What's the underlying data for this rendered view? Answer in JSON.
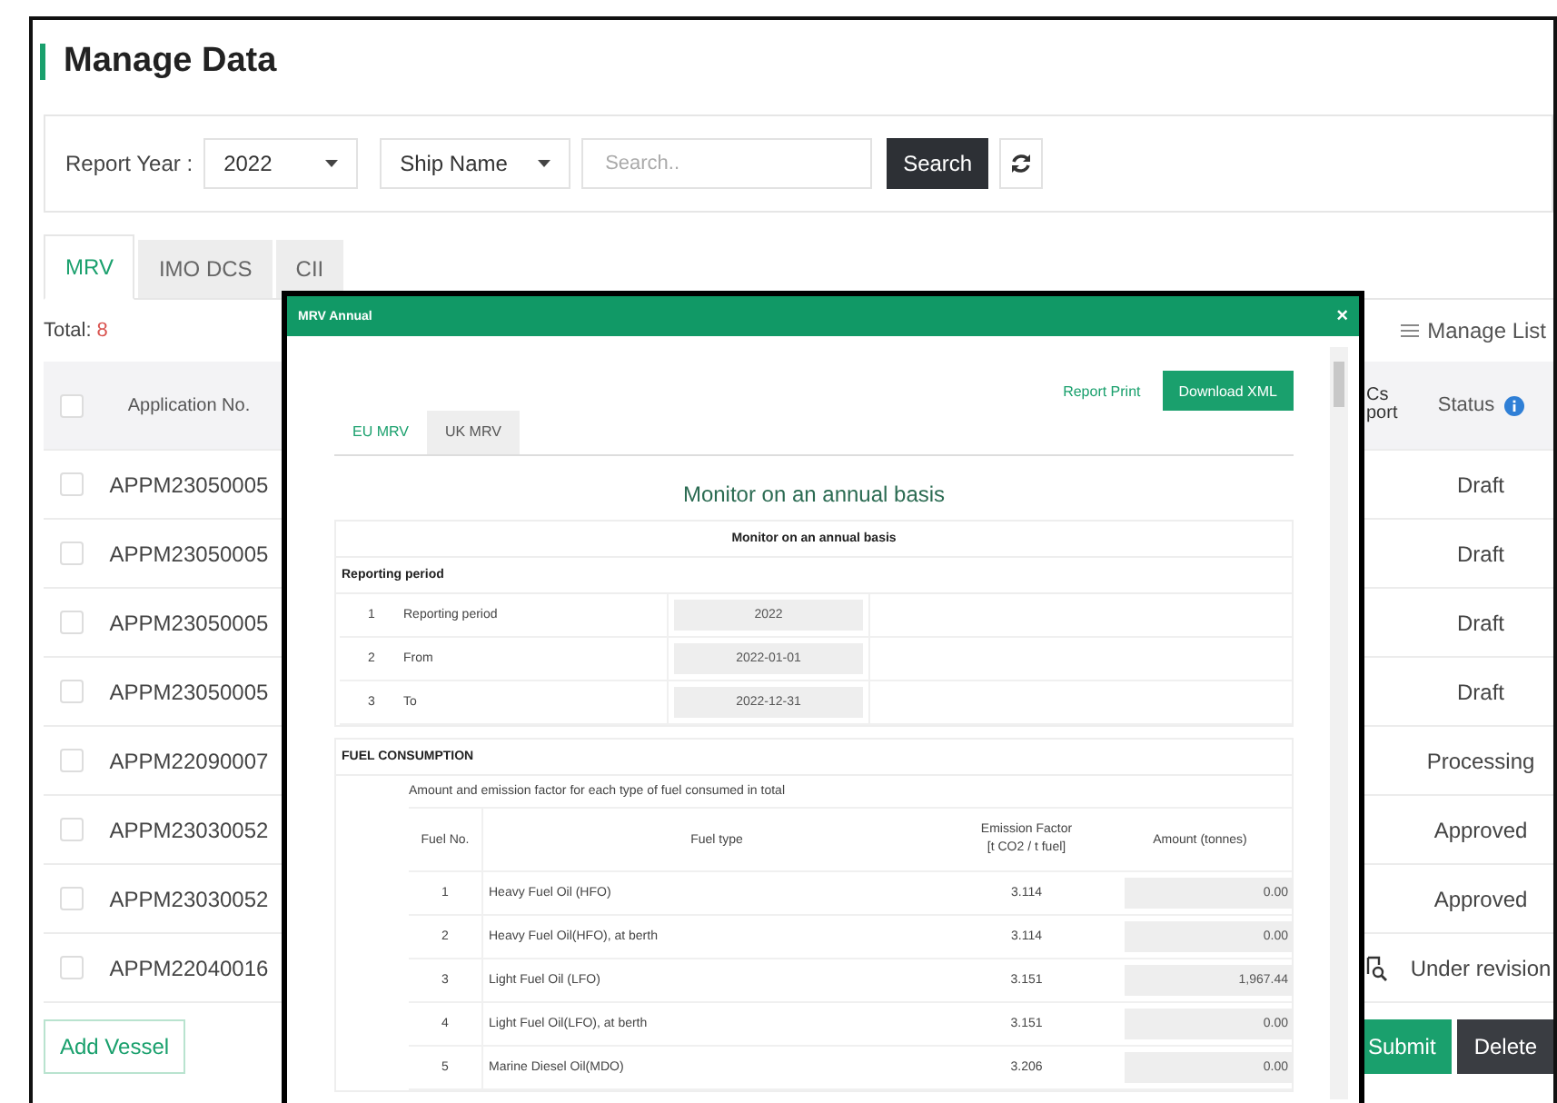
{
  "page": {
    "title": "Manage Data",
    "filters": {
      "year_label": "Report Year :",
      "year": "2022",
      "ship": "Ship Name",
      "search_placeholder": "Search..",
      "search_button": "Search"
    },
    "tabs": [
      {
        "label": "MRV",
        "selected": true
      },
      {
        "label": "IMO DCS",
        "selected": false
      },
      {
        "label": "CII",
        "selected": false
      }
    ],
    "total_label": "Total:",
    "total_count": "8",
    "manage_list": "Manage List",
    "columns": [
      "Application No.",
      "Cs\nport",
      "Status"
    ],
    "header_checked": false,
    "rows": [
      {
        "application_no": "APPM23050005",
        "status": "Draft",
        "checked": false,
        "preview_icon": false
      },
      {
        "application_no": "APPM23050005",
        "status": "Draft",
        "checked": false,
        "preview_icon": false
      },
      {
        "application_no": "APPM23050005",
        "status": "Draft",
        "checked": false,
        "preview_icon": false
      },
      {
        "application_no": "APPM23050005",
        "status": "Draft",
        "checked": false,
        "preview_icon": false
      },
      {
        "application_no": "APPM22090007",
        "status": "Processing",
        "checked": false,
        "preview_icon": false
      },
      {
        "application_no": "APPM23030052",
        "status": "Approved",
        "checked": false,
        "preview_icon": false
      },
      {
        "application_no": "APPM23030052",
        "status": "Approved",
        "checked": false,
        "preview_icon": false
      },
      {
        "application_no": "APPM22040016",
        "status": "Under revision",
        "checked": false,
        "preview_icon": true
      }
    ],
    "buttons": [
      {
        "label": "Add Vessel",
        "kind": "outline"
      },
      {
        "label": "Submit",
        "kind": "primary"
      },
      {
        "label": "Delete",
        "kind": "dark"
      }
    ]
  },
  "modal": {
    "title": "MRV Annual",
    "close": "×",
    "buttons": [
      {
        "label": "Report Print",
        "kind": "outline"
      },
      {
        "label": "Download XML",
        "kind": "primary"
      }
    ],
    "tabs": [
      {
        "label": "EU MRV",
        "selected": true
      },
      {
        "label": "UK MRV",
        "selected": false
      }
    ],
    "heading": "Monitor on an annual basis",
    "table_title": "Monitor on an annual basis",
    "period_section": "Reporting period",
    "period_rows": [
      {
        "no": "1",
        "label": "Reporting period",
        "value": "2022"
      },
      {
        "no": "2",
        "label": "From",
        "value": "2022-01-01"
      },
      {
        "no": "3",
        "label": "To",
        "value": "2022-12-31"
      }
    ],
    "fuel_section": "FUEL CONSUMPTION",
    "fuel_description": "Amount and emission factor for each type of fuel consumed in total",
    "fuel_columns": [
      "Fuel No.",
      "Fuel type",
      "Emission Factor\n[t CO2 / t fuel]",
      "Amount (tonnes)"
    ],
    "fuel_rows": [
      {
        "no": "1",
        "type": "Heavy Fuel Oil (HFO)",
        "factor": "3.114",
        "amount": "0.00"
      },
      {
        "no": "2",
        "type": "Heavy Fuel Oil(HFO), at berth",
        "factor": "3.114",
        "amount": "0.00"
      },
      {
        "no": "3",
        "type": "Light Fuel Oil (LFO)",
        "factor": "3.151",
        "amount": "1,967.44"
      },
      {
        "no": "4",
        "type": "Light Fuel Oil(LFO), at berth",
        "factor": "3.151",
        "amount": "0.00"
      },
      {
        "no": "5",
        "type": "Marine Diesel Oil(MDO)",
        "factor": "3.206",
        "amount": "0.00"
      }
    ]
  }
}
